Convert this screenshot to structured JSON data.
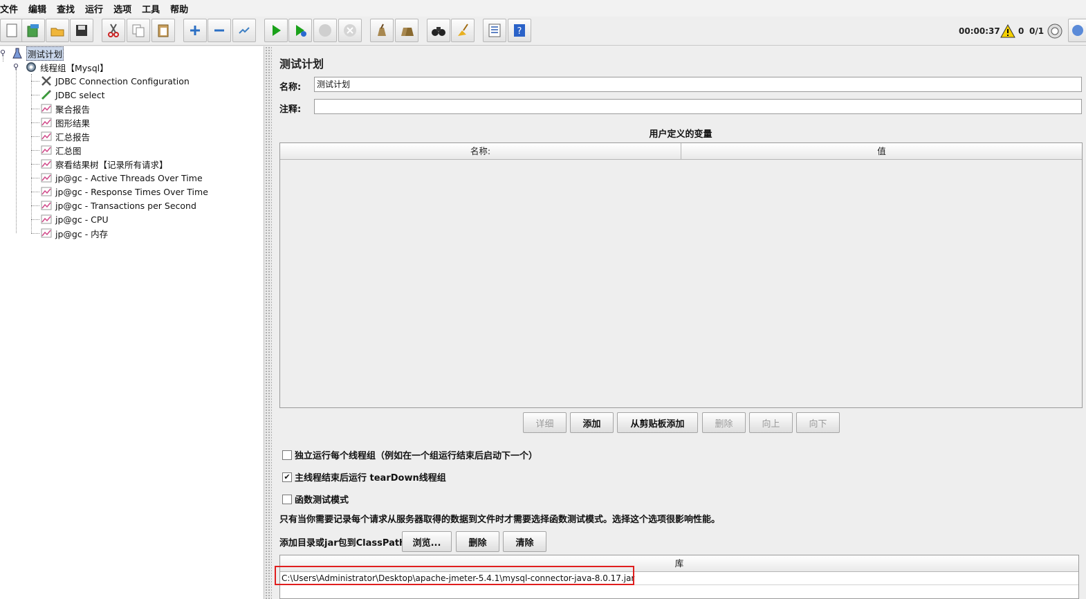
{
  "menu": [
    "文件",
    "编辑",
    "查找",
    "运行",
    "选项",
    "工具",
    "帮助"
  ],
  "toolbar": {
    "buttons": [
      "new-icon",
      "templates-icon",
      "open-icon",
      "save-icon",
      "cut-icon",
      "copy-icon",
      "paste-icon",
      "expand-icon",
      "collapse-icon",
      "toggle-icon",
      "start-icon",
      "start-no-pause-icon",
      "stop-icon",
      "shutdown-icon",
      "clear-icon",
      "clear-all-icon",
      "search-icon",
      "reset-search-icon",
      "function-helper-icon",
      "help-icon"
    ],
    "elapsed": "00:00:37",
    "warnings": "0",
    "threads": "0/1"
  },
  "tree": {
    "root": "测试计划",
    "thread_group": "线程组【Mysql】",
    "children": [
      "JDBC Connection Configuration",
      "JDBC select",
      "聚合报告",
      "图形结果",
      "汇总报告",
      "汇总图",
      "察看结果树【记录所有请求】",
      "jp@gc - Active Threads Over Time",
      "jp@gc - Response Times Over Time",
      "jp@gc - Transactions per Second",
      "jp@gc - CPU",
      "jp@gc - 内存"
    ]
  },
  "panel": {
    "title": "测试计划",
    "name_label": "名称:",
    "name_value": "测试计划",
    "comment_label": "注释:",
    "comment_value": "",
    "vars_title": "用户定义的变量",
    "vars_columns": [
      "名称:",
      "值"
    ],
    "buttons": {
      "detail": "详细",
      "add": "添加",
      "add_clipboard": "从剪贴板添加",
      "delete": "删除",
      "up": "向上",
      "down": "向下"
    },
    "checkbox_serialize": "独立运行每个线程组（例如在一个组运行结束后启动下一个）",
    "checkbox_teardown": "主线程结束后运行 tearDown线程组",
    "checkbox_functional": "函数测试模式",
    "functional_note": "只有当你需要记录每个请求从服务器取得的数据到文件时才需要选择函数测试模式。选择这个选项很影响性能。",
    "classpath_label": "添加目录或jar包到ClassPath",
    "classpath_buttons": {
      "browse": "浏览...",
      "delete": "删除",
      "clear": "清除"
    },
    "lib_header": "库",
    "lib_entry": "C:\\Users\\Administrator\\Desktop\\apache-jmeter-5.4.1\\mysql-connector-java-8.0.17.jar"
  },
  "state": {
    "serialize_checked": false,
    "teardown_checked": true,
    "functional_checked": false
  }
}
